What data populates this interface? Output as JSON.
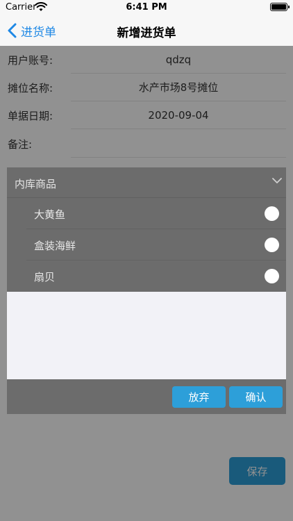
{
  "status_bar": {
    "carrier": "Carrier",
    "time": "6:41 PM"
  },
  "nav": {
    "back_label": "进货单",
    "title": "新增进货单"
  },
  "form": {
    "fields": [
      {
        "label": "用户账号:",
        "value": "qdzq"
      },
      {
        "label": "摊位名称:",
        "value": "水产市场8号摊位"
      },
      {
        "label": "单据日期:",
        "value": "2020-09-04"
      },
      {
        "label": "备注:",
        "value": ""
      }
    ]
  },
  "footer": {
    "save_label": "保存"
  },
  "modal": {
    "title": "内库商品",
    "options": [
      {
        "label": "大黄鱼",
        "selected": false
      },
      {
        "label": "盒装海鲜",
        "selected": false
      },
      {
        "label": "扇贝",
        "selected": false
      }
    ],
    "discard_label": "放弃",
    "confirm_label": "确认"
  },
  "icons": {
    "back": "chevron-left-icon",
    "collapse": "chevron-down-icon",
    "wifi": "wifi-icon",
    "battery": "battery-icon",
    "radio": "radio-unchecked-icon"
  },
  "colors": {
    "accent": "#1e88e5",
    "button": "#2d9fd9",
    "modal_bg": "#6c6c6c",
    "overlay": "#6e6e6e"
  }
}
